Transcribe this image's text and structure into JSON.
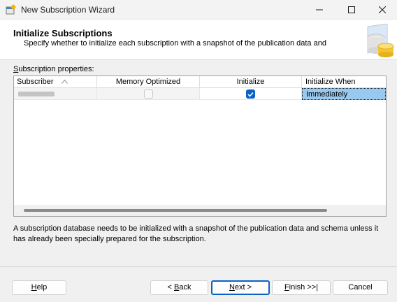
{
  "window": {
    "title": "New Subscription Wizard"
  },
  "header": {
    "title": "Initialize Subscriptions",
    "subtitle": "Specify whether to initialize each subscription with a snapshot of the publication data and"
  },
  "properties": {
    "label_accel": "S",
    "label_rest": "ubscription properties:",
    "columns": [
      "Subscriber",
      "Memory Optimized",
      "Initialize",
      "Initialize When"
    ],
    "rows": [
      {
        "subscriber": "",
        "memory_optimized": false,
        "initialize": true,
        "initialize_when": "Immediately"
      }
    ]
  },
  "description": "A subscription database needs to be initialized with a snapshot of the publication data and schema unless it has already been specially prepared for the subscription.",
  "buttons": {
    "help": {
      "accel": "H",
      "rest": "elp"
    },
    "back": {
      "pre": "< ",
      "accel": "B",
      "rest": "ack"
    },
    "next": {
      "accel": "N",
      "rest": "ext >"
    },
    "finish": {
      "accel": "F",
      "rest": "inish >>|"
    },
    "cancel": {
      "label": "Cancel"
    }
  },
  "colors": {
    "accent": "#0a62c6",
    "selected_cell": "#99c9ef"
  }
}
